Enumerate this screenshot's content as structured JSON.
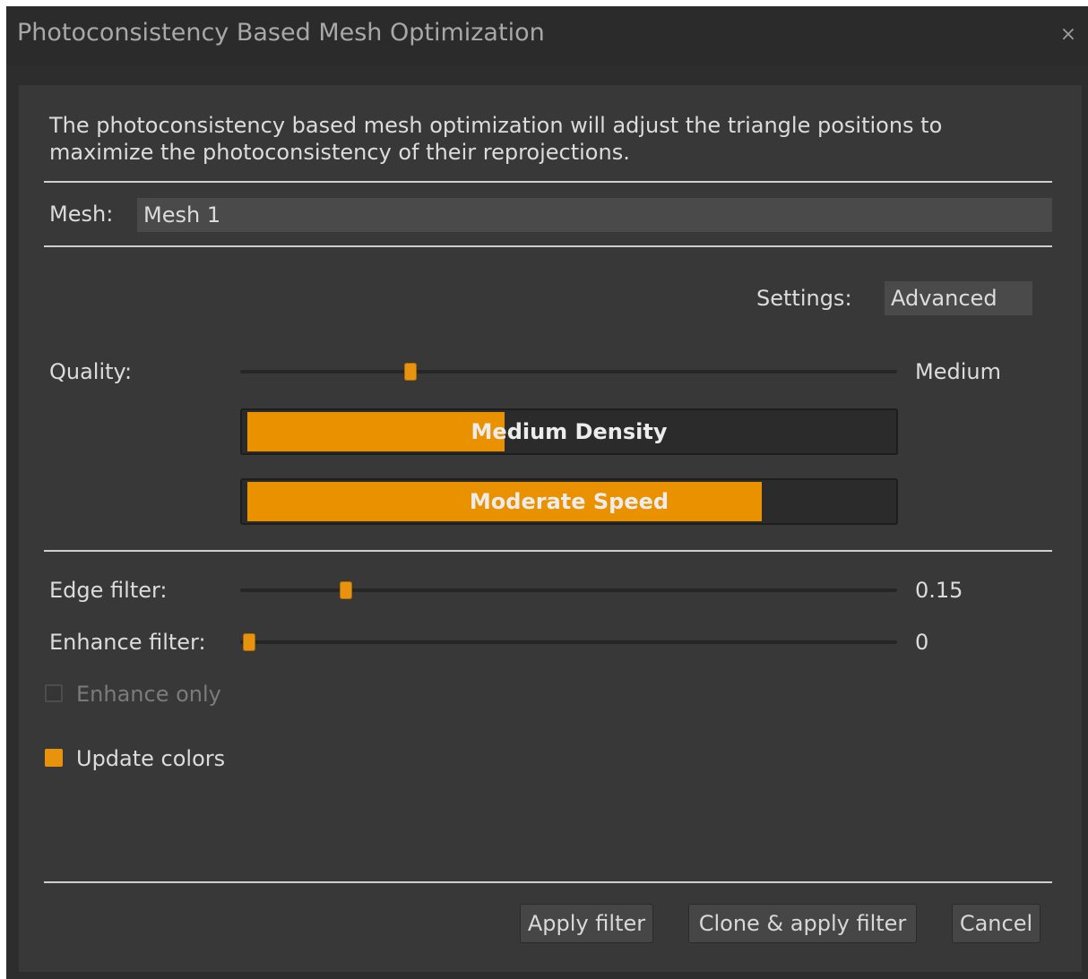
{
  "window": {
    "title": "Photoconsistency Based Mesh Optimization",
    "close_glyph": "×"
  },
  "description": "The photoconsistency based mesh optimization will adjust the triangle positions to maximize the photoconsistency of their reprojections.",
  "mesh": {
    "label": "Mesh:",
    "value": "Mesh 1"
  },
  "settings": {
    "label": "Settings:",
    "value": "Advanced"
  },
  "quality": {
    "label": "Quality:",
    "value_label": "Medium",
    "slider_fraction": 0.25
  },
  "density_bar": {
    "label": "Medium Density",
    "fill_fraction": 0.4
  },
  "speed_bar": {
    "label": "Moderate Speed",
    "fill_fraction": 0.8
  },
  "edge_filter": {
    "label": "Edge filter:",
    "value": "0.15",
    "slider_fraction": 0.15
  },
  "enhance_filter": {
    "label": "Enhance filter:",
    "value": "0",
    "slider_fraction": 0
  },
  "enhance_only": {
    "label": "Enhance only",
    "checked": false,
    "enabled": false
  },
  "update_colors": {
    "label": "Update colors",
    "checked": true
  },
  "buttons": {
    "apply": "Apply filter",
    "clone_apply": "Clone & apply filter",
    "cancel": "Cancel"
  },
  "colors": {
    "accent": "#e8930d",
    "background": "#383838",
    "titlebar": "#2b2b2b"
  },
  "icons": {
    "close": "close-icon",
    "checkbox_on": "checkbox-checked-icon",
    "checkbox_off": "checkbox-unchecked-icon"
  }
}
